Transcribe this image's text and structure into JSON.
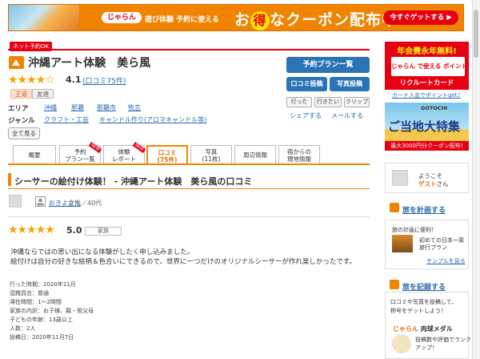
{
  "banner": {
    "logo": "じゃらん",
    "small_text": "遊び体験 予約に使える",
    "headline_prefix": "お",
    "headline_toku": "得",
    "headline_suffix": "なクーポン配布中!",
    "cta": "今すぐゲットする ▶"
  },
  "facility": {
    "net_badge": "ネット予約OK",
    "name": "沖縄アート体験　美ら風",
    "stars": "★★★★☆",
    "rating": "4.1",
    "reviews_link": "(口コミ75件)",
    "tags": [
      "王道",
      "友達"
    ],
    "area_label": "エリア",
    "area_links": [
      "沖縄",
      "那覇",
      "那覇市",
      "牧志"
    ],
    "genre_label": "ジャンル",
    "genre_links": [
      "クラフト・工芸",
      "キャンドル作り(アロマキャンドル等)"
    ],
    "show_all": "全て見る"
  },
  "actions": {
    "reserve_plan": "予約プラン一覧",
    "write_review": "口コミ投稿",
    "post_photo": "写真投稿",
    "went": "行った",
    "want": "行きたい",
    "clip": "クリップ",
    "share": "シェアする",
    "mail": "メールする"
  },
  "tabs": [
    {
      "line1": "概要",
      "line2": ""
    },
    {
      "line1": "予約",
      "line2": "プラン一覧",
      "badge": "NEW"
    },
    {
      "line1": "体験",
      "line2": "レポート",
      "badge": "NEW"
    },
    {
      "line1": "口コミ",
      "line2": "(75件)"
    },
    {
      "line1": "写真",
      "line2": "(11枚)"
    },
    {
      "line1": "周辺情報",
      "line2": ""
    },
    {
      "line1": "宿からの",
      "line2": "現地情報"
    }
  ],
  "review": {
    "heading": "シーサーの絵付け体験！ - 沖縄アート体験　美ら風の口コミ",
    "user_name": "おきよさん",
    "user_meta": "女性／40代",
    "stars": "★★★★★",
    "score": "5.0",
    "party": "家族",
    "body_line1": "沖縄ならではの思い出になる体験がしたく申し込みました。",
    "body_line2": "絵付けは自分の好きな絵柄＆色合いにできるので、世界に一つだけのオリジナルシーサーが作れ楽しかったです。",
    "details": [
      "行った時期：2020年11月",
      "混雑具合：普通",
      "滞在時間：1～2時間",
      "家族の内訳：お子様、親・祖父母",
      "子どもの年齢：13歳以上",
      "人数：2人",
      "投稿日：2020年11月7日"
    ]
  },
  "sidebar": {
    "ad_card": {
      "top": "年会費永年無料!",
      "middle": "じゃらん で使える ポイントがたまる!",
      "bottom": "リクルートカード",
      "link": "カード入会でポイントget♪"
    },
    "ad_gotochi": {
      "label": "GOTOCHI",
      "title": "ご当地大特集",
      "bottom": "最大3000円分クーポン配布!"
    },
    "welcome_line1": "ようこそ",
    "welcome_guest": "ゲスト",
    "welcome_suffix": "さん",
    "plan_title": "旅を計画する",
    "plan_text": "旅の計画に便利！",
    "plan_caption1": "初めての日本一周",
    "plan_caption2": "旅行プラン",
    "plan_link": "サンプルを見る",
    "record_title": "旅を記録する",
    "record_text1": "口コミや写真を投稿して、",
    "record_text2": "称号をゲットしよう！",
    "medal_brand": "じゃらん",
    "medal_title": " 肉球メダル",
    "medal_text1": "投稿数や評価でランク",
    "medal_text2": "アップ！"
  },
  "colors": {
    "accent_orange": "#f08300",
    "brand_red": "#e60012",
    "link_blue": "#2a6ab1",
    "star": "#f5a200"
  }
}
